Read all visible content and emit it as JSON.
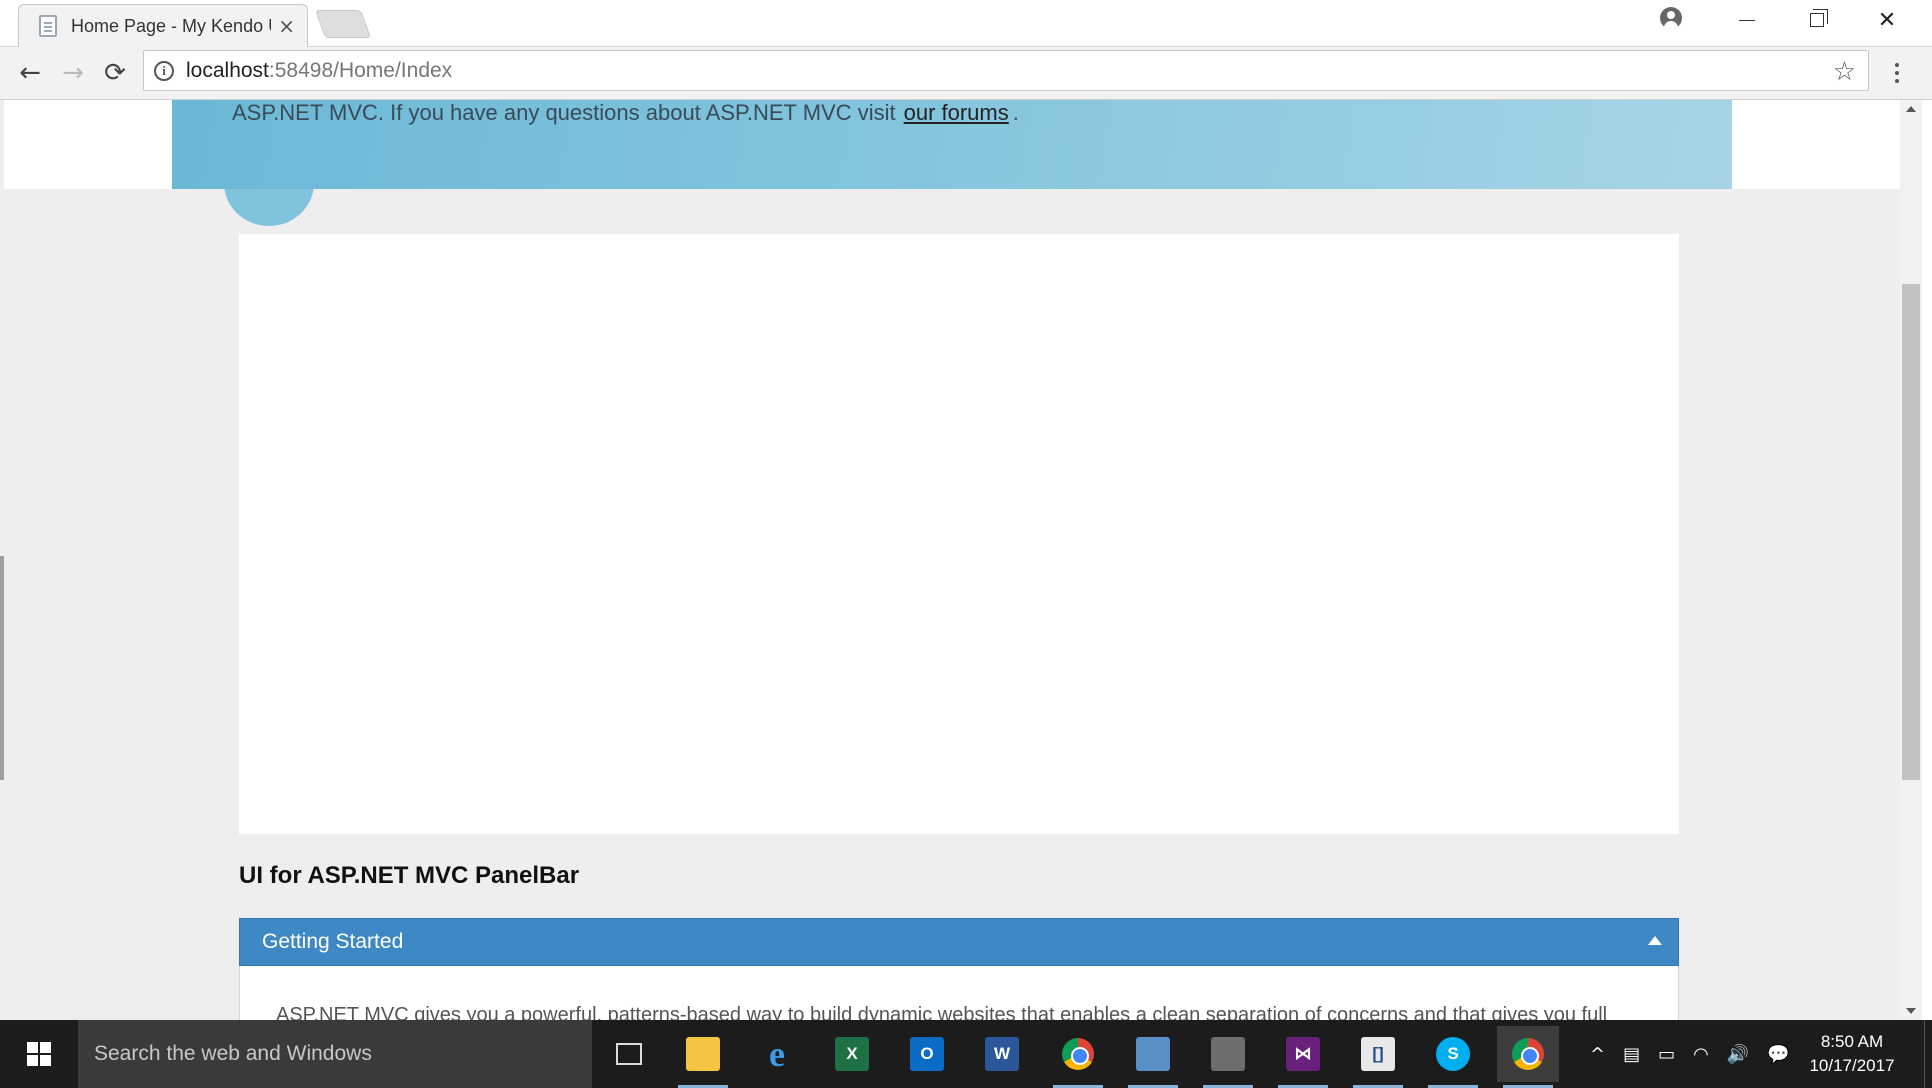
{
  "browser": {
    "tab_title": "Home Page - My Kendo UI",
    "tab_close": "×",
    "url_host": "localhost",
    "url_rest": ":58498/Home/Index",
    "info_symbol": "i",
    "back": "←",
    "forward": "→",
    "reload": "⟳",
    "bookmark": "☆",
    "close_window": "✕"
  },
  "page": {
    "jumbotron_text": "ASP.NET MVC. If you have any questions about ASP.NET MVC visit",
    "forums_link": "our forums",
    "jumbotron_suffix": ".",
    "panelbar_heading": "UI for ASP.NET MVC PanelBar",
    "panel_item_title": "Getting Started",
    "panel_item_content": "ASP.NET MVC gives you a powerful, patterns-based way to build dynamic websites that enables a clean separation of concerns and that gives you full"
  },
  "taskbar": {
    "search_placeholder": "Search the web and Windows",
    "excel_letter": "X",
    "outlook_letter": "O",
    "word_letter": "W",
    "ie_letter": "e",
    "vs_letter": "⋈",
    "bracket_letter": "[]",
    "skype_letter": "S",
    "tray_chevron": "^",
    "tray_volume": "🔊",
    "tray_notification": "💬",
    "time": "8:50 AM",
    "date": "10/17/2017"
  },
  "colors": {
    "panel_header": "#3f88c6",
    "jumbotron_start": "#6ab8d6",
    "jumbotron_end": "#a6d4e6"
  }
}
